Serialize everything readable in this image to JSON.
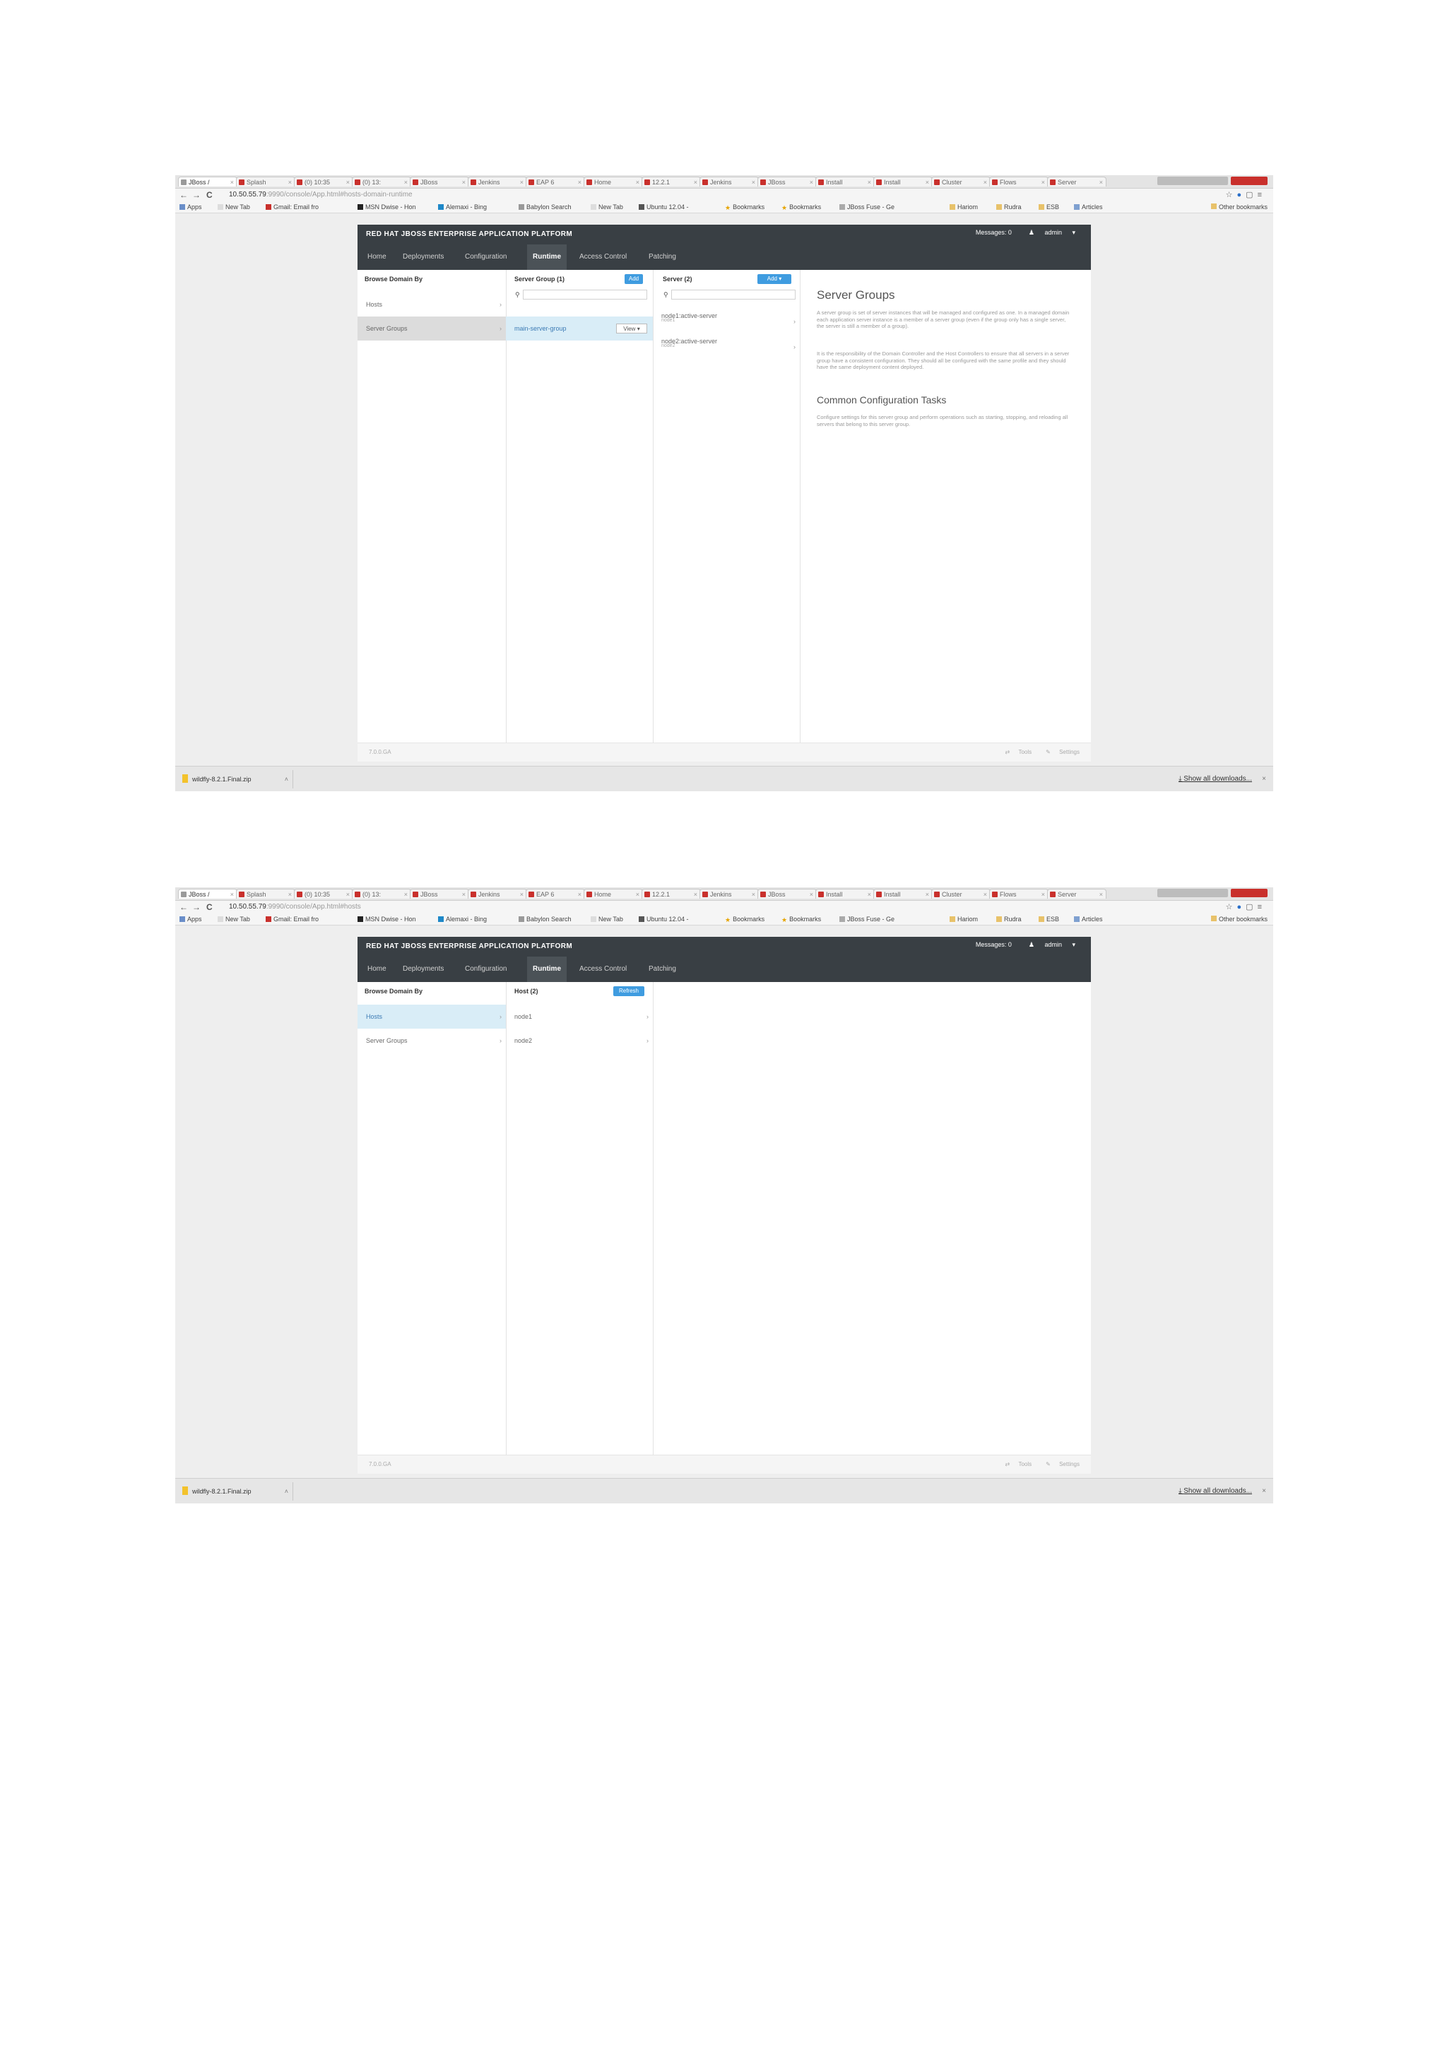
{
  "browser": {
    "tabs": [
      {
        "label": "JBoss /"
      },
      {
        "label": "Splash"
      },
      {
        "label": "(0) 10:35"
      },
      {
        "label": "(0) 13:"
      },
      {
        "label": "JBoss"
      },
      {
        "label": "Jenkins"
      },
      {
        "label": "EAP 6"
      },
      {
        "label": "Home"
      },
      {
        "label": "12.2.1"
      },
      {
        "label": "Jenkins"
      },
      {
        "label": "JBoss"
      },
      {
        "label": "Install"
      },
      {
        "label": "Install"
      },
      {
        "label": "Cluster"
      },
      {
        "label": "Flows"
      },
      {
        "label": "Server"
      }
    ],
    "nav": {
      "back": "←",
      "forward": "→",
      "reload": "C"
    },
    "url": {
      "host": "10.50.55.79",
      "path_1": ":9990/console/App.html#hosts-domain-runtime",
      "path_2": ":9990/console/App.html#hosts"
    },
    "bookmarks": [
      {
        "label": "Apps",
        "icon": "apps-icon"
      },
      {
        "label": "New Tab",
        "icon": "page-icon"
      },
      {
        "label": "Gmail: Email fro",
        "icon": "gmail-icon"
      },
      {
        "label": "MSN Dwise - Hon",
        "icon": "msn-icon"
      },
      {
        "label": "Alemaxi - Bing",
        "icon": "bing-icon"
      },
      {
        "label": "Babylon Search",
        "icon": "search-icon"
      },
      {
        "label": "New Tab",
        "icon": "page-icon"
      },
      {
        "label": "Ubuntu 12.04 -",
        "icon": "ubuntu-icon"
      },
      {
        "label": "Bookmarks",
        "icon": "star-icon"
      },
      {
        "label": "Bookmarks",
        "icon": "star-icon"
      },
      {
        "label": "JBoss Fuse - Ge",
        "icon": "jboss-icon"
      },
      {
        "label": "Hariom",
        "icon": "folder-icon"
      },
      {
        "label": "Rudra",
        "icon": "folder-icon"
      },
      {
        "label": "ESB",
        "icon": "folder-icon"
      },
      {
        "label": "Articles",
        "icon": "article-icon"
      }
    ],
    "other_bookmarks": "Other bookmarks"
  },
  "app": {
    "brand": "RED HAT JBOSS ENTERPRISE APPLICATION PLATFORM",
    "messages": "Messages: 0",
    "user": "admin",
    "nav_tabs": [
      "Home",
      "Deployments",
      "Configuration",
      "Runtime",
      "Access Control",
      "Patching"
    ],
    "active_tab": "Runtime",
    "footer": {
      "version": "7.0.0.GA",
      "tools": "Tools",
      "settings": "Settings"
    }
  },
  "screen1": {
    "col1_header": "Browse Domain By",
    "col1_items": [
      "Hosts",
      "Server Groups"
    ],
    "col2_header": "Server Group (1)",
    "col2_add": "Add",
    "col2_items": [
      {
        "label": "main-server-group",
        "view": "View"
      }
    ],
    "col3_header": "Server (2)",
    "col3_add": "Add",
    "col3_items": [
      {
        "label": "node1:active-server",
        "sub": "node1"
      },
      {
        "label": "node2:active-server",
        "sub": "node2"
      }
    ],
    "preview": {
      "title": "Server Groups",
      "p1": "A server group is set of server instances that will be managed and configured as one. In a managed domain each application server instance is a member of a server group (even if the group only has a single server, the server is still a member of a group).",
      "p2": "It is the responsibility of the Domain Controller and the Host Controllers to ensure that all servers in a server group have a consistent configuration. They should all be configured with the same profile and they should have the same deployment content deployed.",
      "subtitle": "Common Configuration Tasks",
      "p3": "Configure settings for this server group and perform operations such as starting, stopping, and reloading all servers that belong to this server group."
    }
  },
  "screen2": {
    "col1_header": "Browse Domain By",
    "col1_items": [
      "Hosts",
      "Server Groups"
    ],
    "col2_header": "Host (2)",
    "col2_refresh": "Refresh",
    "col2_items": [
      "node1",
      "node2"
    ]
  },
  "downloads": {
    "file": "wildfly-8.2.1.Final.zip",
    "show_all": "Show all downloads..."
  }
}
